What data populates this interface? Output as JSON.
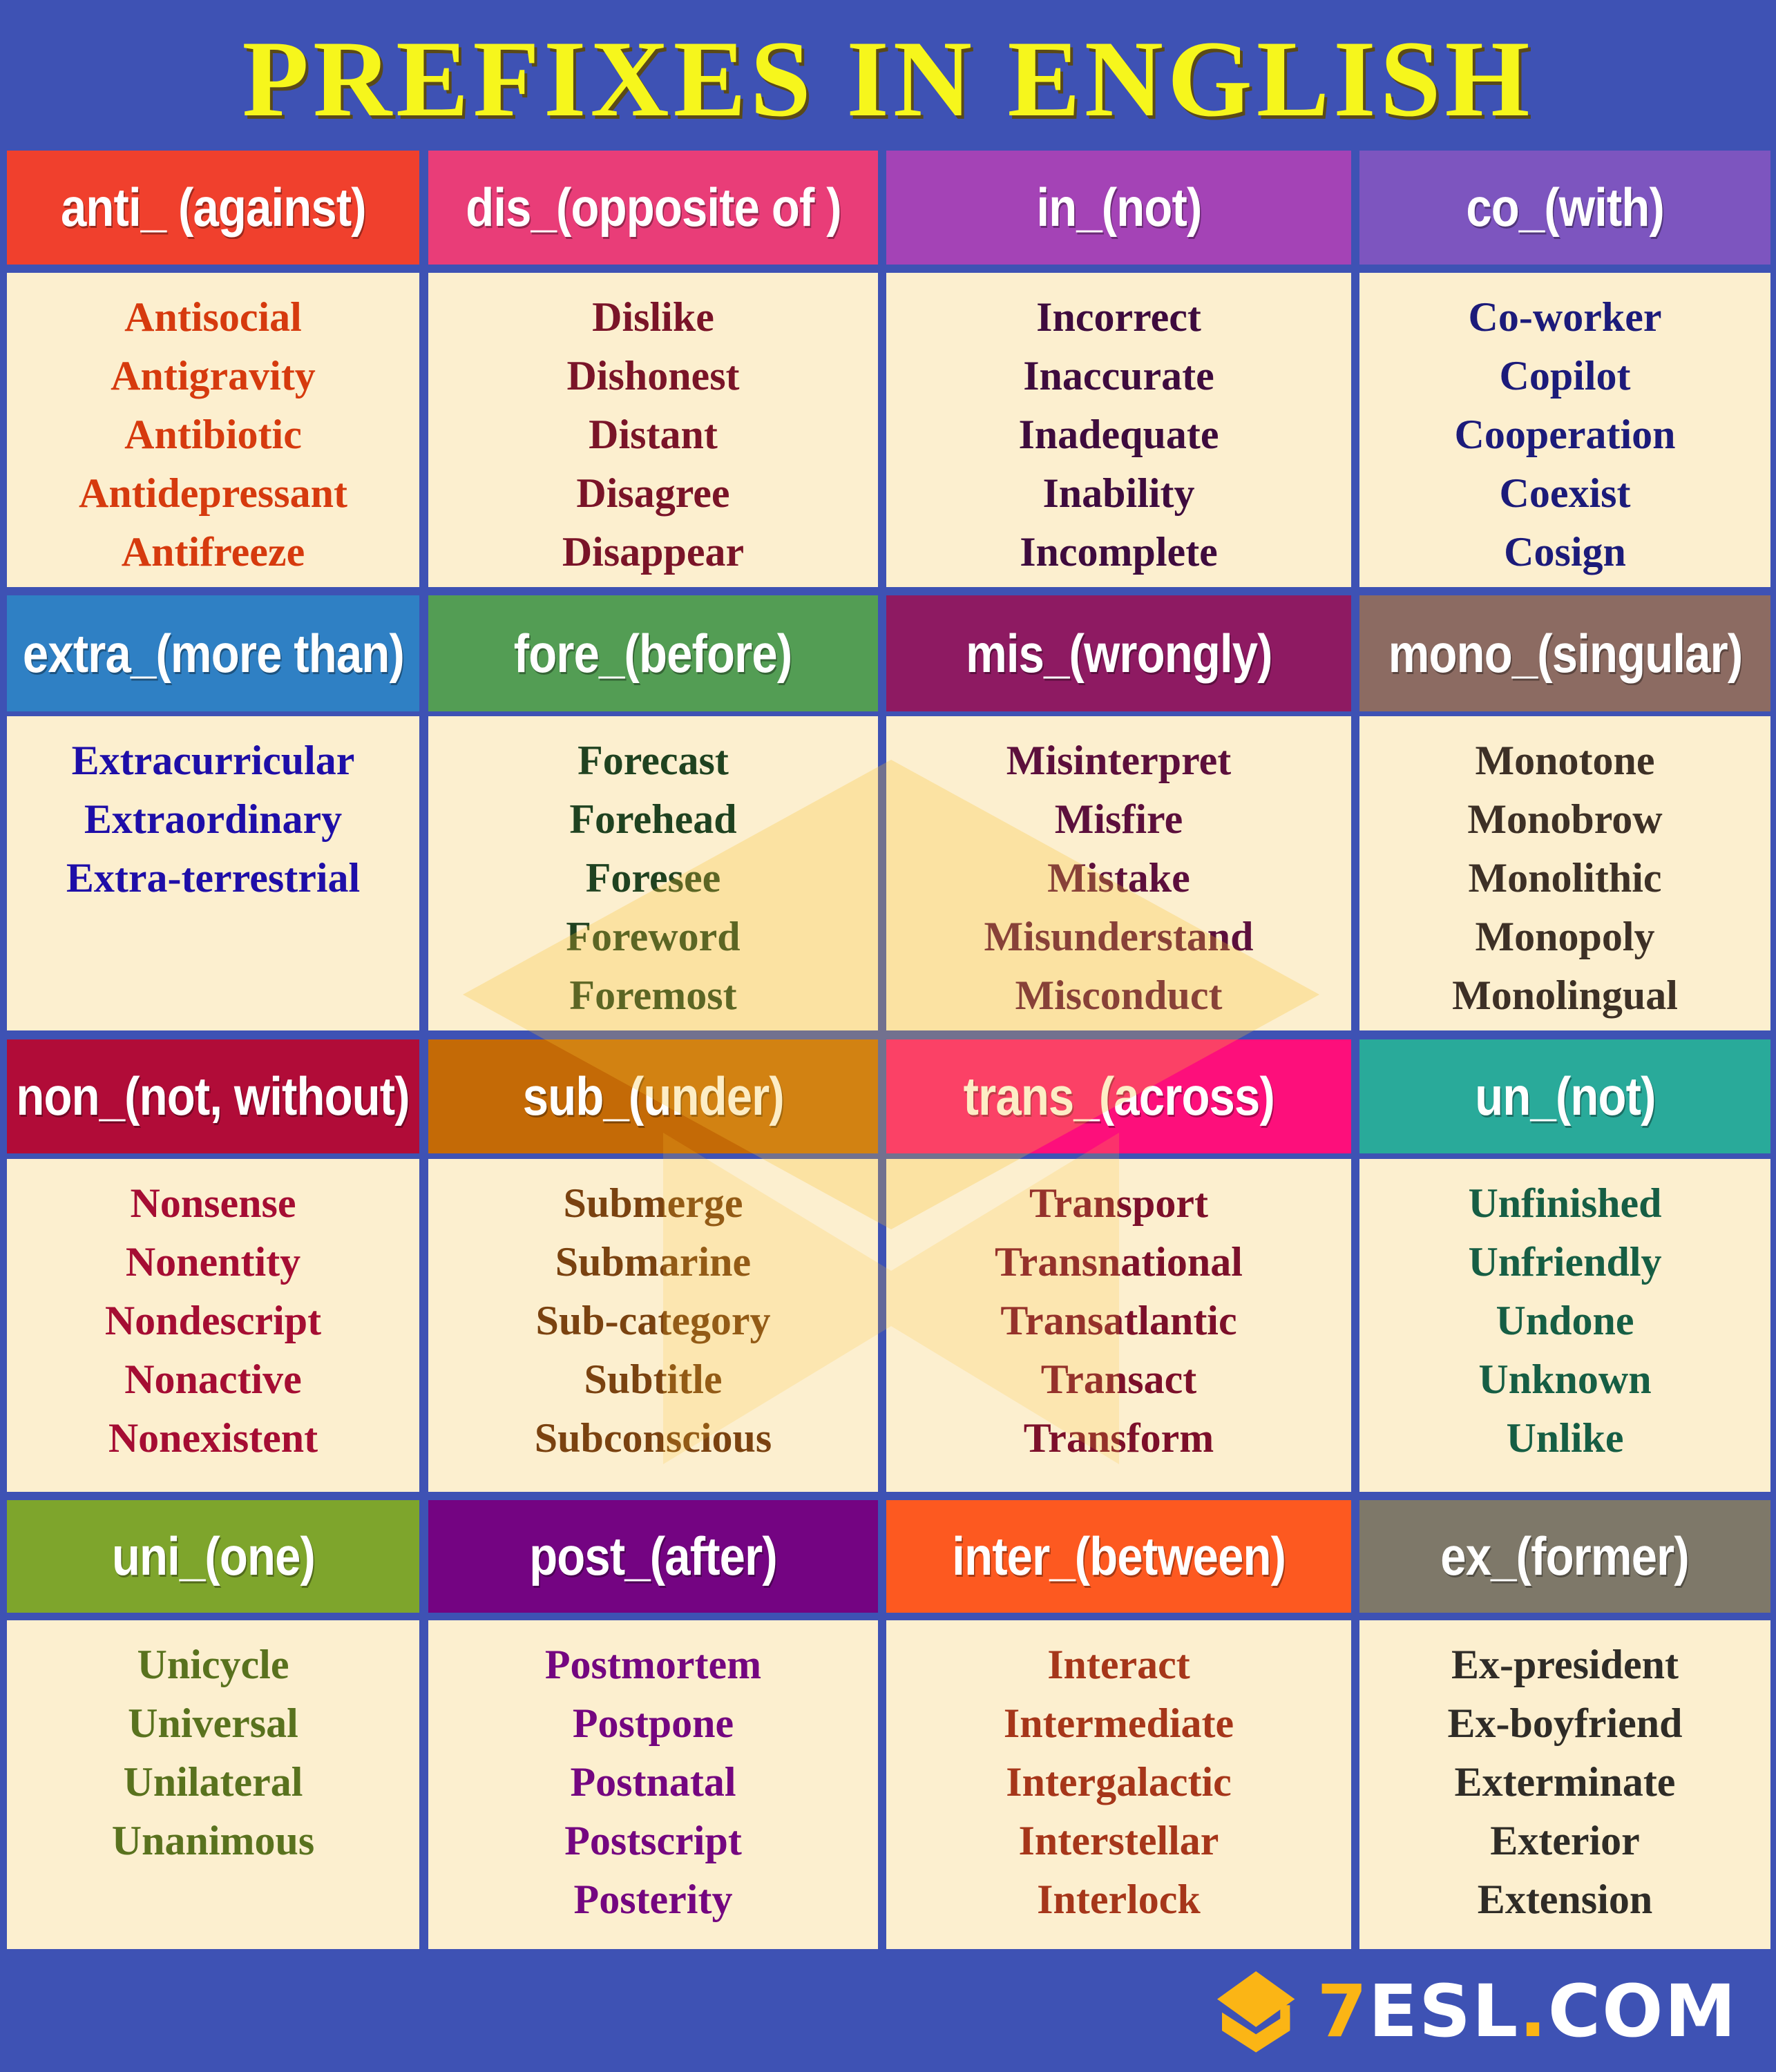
{
  "title": "PREFIXES IN ENGLISH",
  "colors": {
    "background": "#3e52b4",
    "title": "#f6f61c",
    "cell_background": "#fcefcf",
    "logo_accent": "#fbb515"
  },
  "prefixes": [
    {
      "header": "anti_ (against)",
      "header_color": "#f0402d",
      "word_color": "#d63a0e",
      "words": [
        "Antisocial",
        "Antigravity",
        "Antibiotic",
        "Antidepressant",
        "Antifreeze"
      ]
    },
    {
      "header": "dis_(opposite of )",
      "header_color": "#e93d78",
      "word_color": "#7a1428",
      "words": [
        "Dislike",
        "Dishonest",
        "Distant",
        "Disagree",
        "Disappear"
      ]
    },
    {
      "header": "in_(not)",
      "header_color": "#a443b6",
      "word_color": "#3e0b3e",
      "words": [
        "Incorrect",
        "Inaccurate",
        "Inadequate",
        "Inability",
        "Incomplete"
      ]
    },
    {
      "header": "co_(with)",
      "header_color": "#7d55bf",
      "word_color": "#1c1b7a",
      "words": [
        "Co-worker",
        "Copilot",
        "Cooperation",
        "Coexist",
        "Cosign"
      ]
    },
    {
      "header": "extra_(more than)",
      "header_color": "#2f80c4",
      "word_color": "#1e0ea8",
      "words": [
        "Extracurricular",
        "Extraordinary",
        "Extra-terrestrial"
      ]
    },
    {
      "header": "fore_(before)",
      "header_color": "#539d54",
      "word_color": "#1f4220",
      "words": [
        "Forecast",
        "Forehead",
        "Foresee",
        "Foreword",
        "Foremost"
      ]
    },
    {
      "header": "mis_(wrongly)",
      "header_color": "#8e1a62",
      "word_color": "#5c0f3c",
      "words": [
        "Misinterpret",
        "Misfire",
        "Mistake",
        "Misunderstand",
        "Misconduct"
      ]
    },
    {
      "header": "mono_(singular)",
      "header_color": "#8c6b62",
      "word_color": "#3d3026",
      "words": [
        "Monotone",
        "Monobrow",
        "Monolithic",
        "Monopoly",
        "Monolingual"
      ]
    },
    {
      "header": "non_(not, without)",
      "header_color": "#b10c38",
      "word_color": "#a50d33",
      "words": [
        "Nonsense",
        "Nonentity",
        "Nondescript",
        "Nonactive",
        "Nonexistent"
      ]
    },
    {
      "header": "sub_(under)",
      "header_color": "#c46a06",
      "word_color": "#7a4210",
      "words": [
        "Submerge",
        "Submarine",
        "Sub-category",
        "Subtitle",
        "Subconscious"
      ]
    },
    {
      "header": "trans_(across)",
      "header_color": "#fd0f7b",
      "word_color": "#7c0f2a",
      "words": [
        "Transport",
        "Transnational",
        "Transatlantic",
        "Transact",
        "Transform"
      ]
    },
    {
      "header": "un_(not)",
      "header_color": "#29aa9a",
      "word_color": "#165e44",
      "words": [
        "Unfinished",
        "Unfriendly",
        "Undone",
        "Unknown",
        "Unlike"
      ]
    },
    {
      "header": "uni_(one)",
      "header_color": "#7ea52c",
      "word_color": "#59721e",
      "words": [
        "Unicycle",
        "Universal",
        "Unilateral",
        "Unanimous"
      ]
    },
    {
      "header": "post_(after)",
      "header_color": "#740482",
      "word_color": "#740680",
      "words": [
        "Postmortem",
        "Postpone",
        "Postnatal",
        "Postscript",
        "Posterity"
      ]
    },
    {
      "header": "inter_(between)",
      "header_color": "#fd5920",
      "word_color": "#a6361a",
      "words": [
        "Interact",
        "Intermediate",
        "Intergalactic",
        "Interstellar",
        "Interlock"
      ]
    },
    {
      "header": "ex_(former)",
      "header_color": "#7e7869",
      "word_color": "#2f2c27",
      "words": [
        "Ex-president",
        "Ex-boyfriend",
        "Exterminate",
        "Exterior",
        "Extension"
      ]
    }
  ],
  "logo": {
    "accent_part": "7",
    "main_part": "ESL",
    "dot": ".",
    "suffix": "COM",
    "icon": "graduation-cap-icon"
  }
}
